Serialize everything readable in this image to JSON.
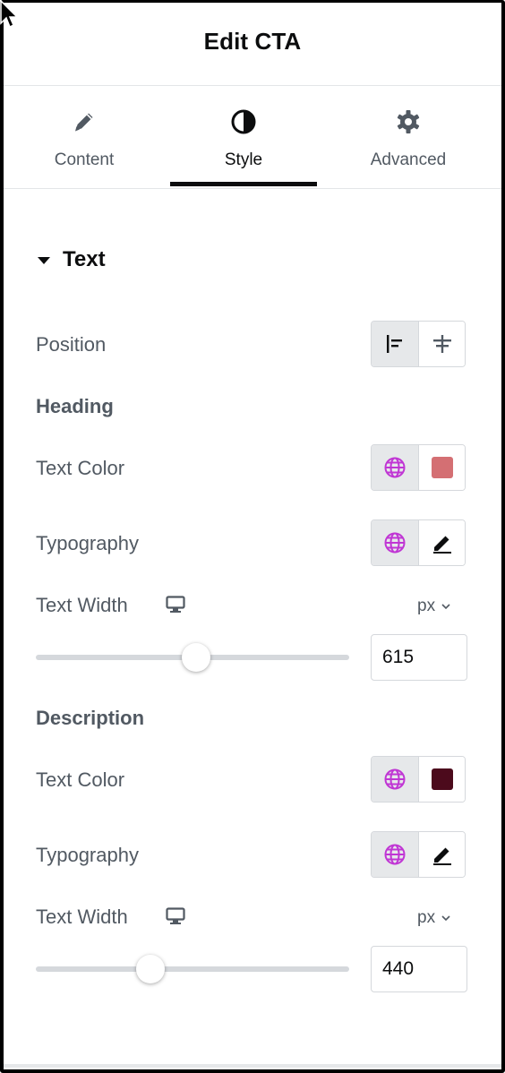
{
  "header": {
    "title": "Edit CTA"
  },
  "tabs": [
    {
      "label": "Content",
      "icon": "pencil-icon"
    },
    {
      "label": "Style",
      "icon": "half-circle-icon",
      "active": true
    },
    {
      "label": "Advanced",
      "icon": "gear-icon"
    }
  ],
  "section": {
    "title": "Text",
    "expanded": true
  },
  "position": {
    "label": "Position",
    "options": [
      "align-start-icon",
      "align-center-icon"
    ],
    "selected": "align-start-icon"
  },
  "heading": {
    "title": "Heading",
    "text_color": {
      "label": "Text Color",
      "swatch": "#d46f73",
      "global_icon": "globe-icon"
    },
    "typography": {
      "label": "Typography",
      "global_icon": "globe-icon",
      "edit_icon": "pencil-icon"
    },
    "text_width": {
      "label": "Text Width",
      "device_icon": "desktop-icon",
      "unit": "px",
      "value": "615",
      "slider_fraction": 0.51
    }
  },
  "description": {
    "title": "Description",
    "text_color": {
      "label": "Text Color",
      "swatch": "#4c0a1c",
      "global_icon": "globe-icon"
    },
    "typography": {
      "label": "Typography",
      "global_icon": "globe-icon",
      "edit_icon": "pencil-icon"
    },
    "text_width": {
      "label": "Text Width",
      "device_icon": "desktop-icon",
      "unit": "px",
      "value": "440",
      "slider_fraction": 0.365
    }
  },
  "colors": {
    "global_accent": "#c036d4",
    "active_tab": "#0c0d0e",
    "label": "#515962"
  }
}
